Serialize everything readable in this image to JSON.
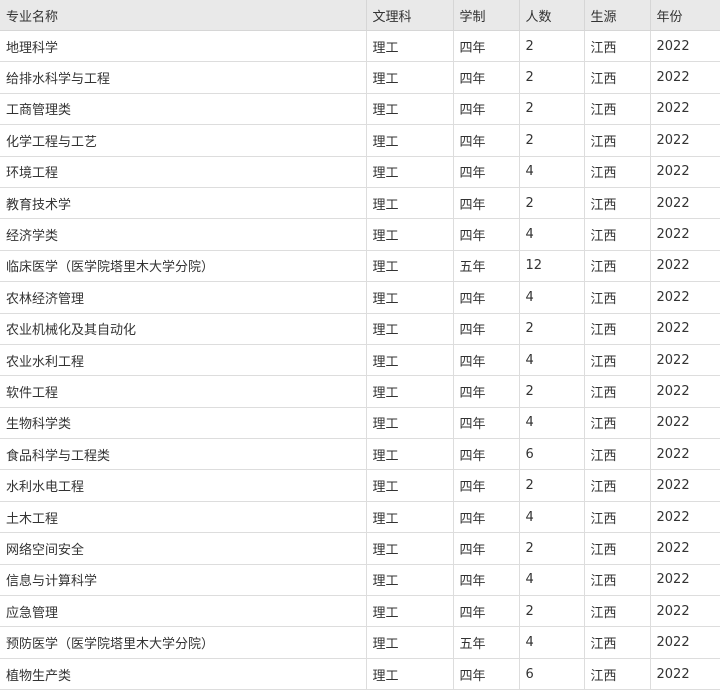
{
  "table": {
    "headers": [
      "专业名称",
      "文理科",
      "学制",
      "人数",
      "生源",
      "年份"
    ],
    "rows": [
      [
        "地理科学",
        "理工",
        "四年",
        "2",
        "江西",
        "2022"
      ],
      [
        "给排水科学与工程",
        "理工",
        "四年",
        "2",
        "江西",
        "2022"
      ],
      [
        "工商管理类",
        "理工",
        "四年",
        "2",
        "江西",
        "2022"
      ],
      [
        "化学工程与工艺",
        "理工",
        "四年",
        "2",
        "江西",
        "2022"
      ],
      [
        "环境工程",
        "理工",
        "四年",
        "4",
        "江西",
        "2022"
      ],
      [
        "教育技术学",
        "理工",
        "四年",
        "2",
        "江西",
        "2022"
      ],
      [
        "经济学类",
        "理工",
        "四年",
        "4",
        "江西",
        "2022"
      ],
      [
        "临床医学（医学院塔里木大学分院）",
        "理工",
        "五年",
        "12",
        "江西",
        "2022"
      ],
      [
        "农林经济管理",
        "理工",
        "四年",
        "4",
        "江西",
        "2022"
      ],
      [
        "农业机械化及其自动化",
        "理工",
        "四年",
        "2",
        "江西",
        "2022"
      ],
      [
        "农业水利工程",
        "理工",
        "四年",
        "4",
        "江西",
        "2022"
      ],
      [
        "软件工程",
        "理工",
        "四年",
        "2",
        "江西",
        "2022"
      ],
      [
        "生物科学类",
        "理工",
        "四年",
        "4",
        "江西",
        "2022"
      ],
      [
        "食品科学与工程类",
        "理工",
        "四年",
        "6",
        "江西",
        "2022"
      ],
      [
        "水利水电工程",
        "理工",
        "四年",
        "2",
        "江西",
        "2022"
      ],
      [
        "土木工程",
        "理工",
        "四年",
        "4",
        "江西",
        "2022"
      ],
      [
        "网络空间安全",
        "理工",
        "四年",
        "2",
        "江西",
        "2022"
      ],
      [
        "信息与计算科学",
        "理工",
        "四年",
        "4",
        "江西",
        "2022"
      ],
      [
        "应急管理",
        "理工",
        "四年",
        "2",
        "江西",
        "2022"
      ],
      [
        "预防医学（医学院塔里木大学分院）",
        "理工",
        "五年",
        "4",
        "江西",
        "2022"
      ],
      [
        "植物生产类",
        "理工",
        "四年",
        "6",
        "江西",
        "2022"
      ]
    ]
  }
}
